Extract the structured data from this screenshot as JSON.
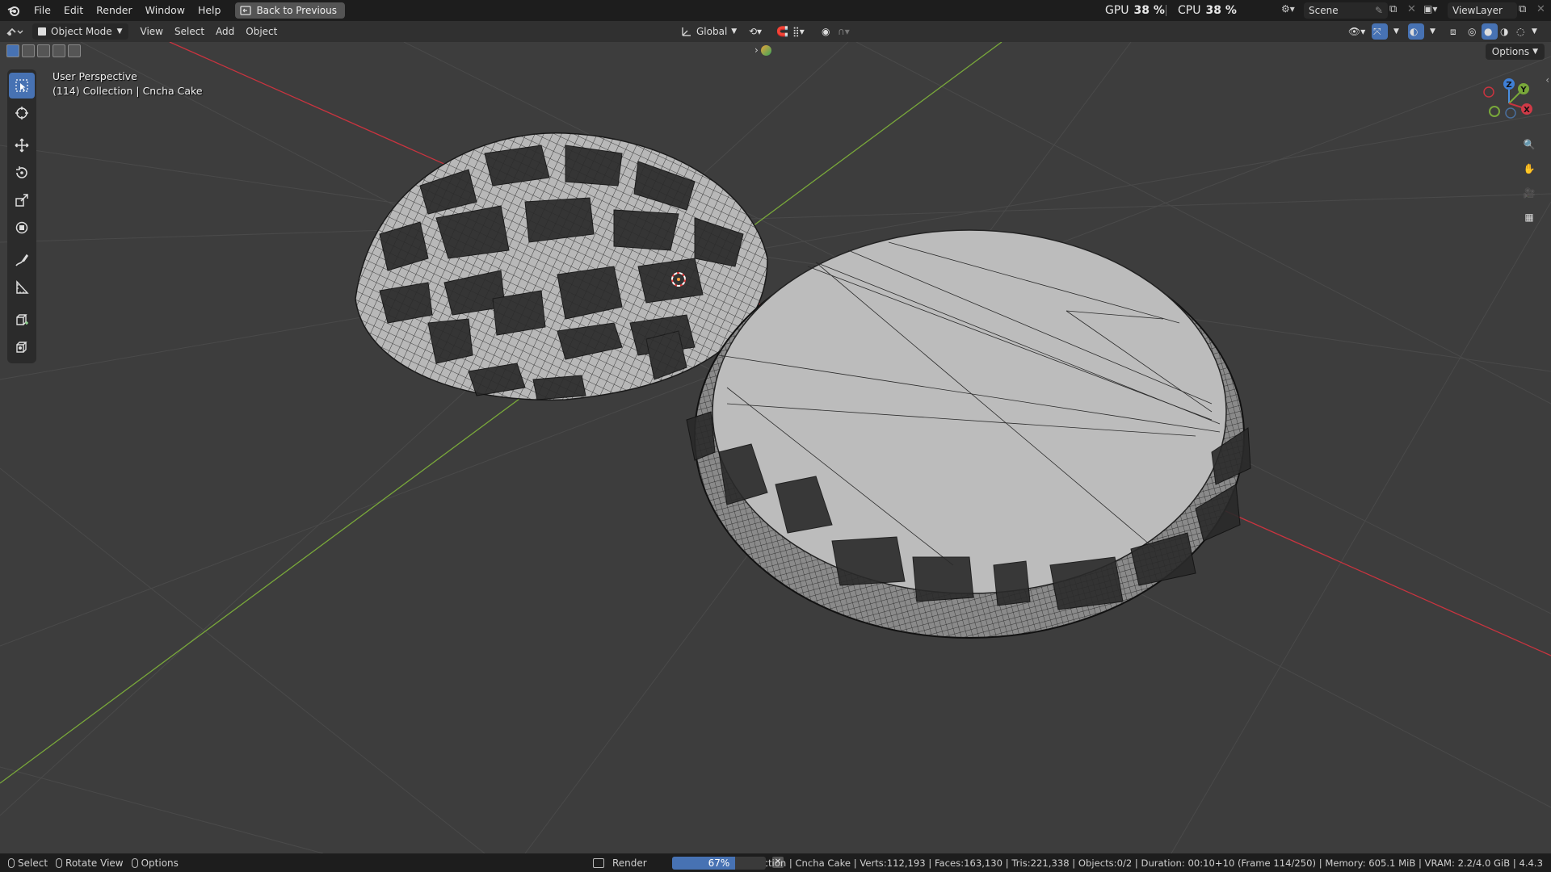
{
  "topbar": {
    "menu": [
      "File",
      "Edit",
      "Render",
      "Window",
      "Help"
    ],
    "back_button": "Back to Previous",
    "gpu_label": "GPU",
    "gpu_value": "38 %",
    "cpu_label": "CPU",
    "cpu_value": "38 %",
    "scene": "Scene",
    "view_layer": "ViewLayer"
  },
  "header": {
    "mode": "Object Mode",
    "menu": [
      "View",
      "Select",
      "Add",
      "Object"
    ],
    "orientation": "Global",
    "options": "Options"
  },
  "viewport": {
    "line1": "User Perspective",
    "line2": "(114) Collection | Cncha Cake"
  },
  "status": {
    "select": "Select",
    "rotate": "Rotate View",
    "options": "Options",
    "render_label": "Render",
    "progress_text": "67%",
    "progress_value": 0.67,
    "stats": "Collection | Cncha Cake | Verts:112,193 | Faces:163,130 | Tris:221,338 | Objects:0/2 | Duration: 00:10+10 (Frame 114/250) | Memory: 605.1 MiB | VRAM: 2.2/4.0 GiB | 4.4.3"
  },
  "colors": {
    "accent": "#4772b3",
    "x_axis": "#c8343f",
    "y_axis": "#79a83a",
    "z_axis": "#4a8fe0"
  }
}
